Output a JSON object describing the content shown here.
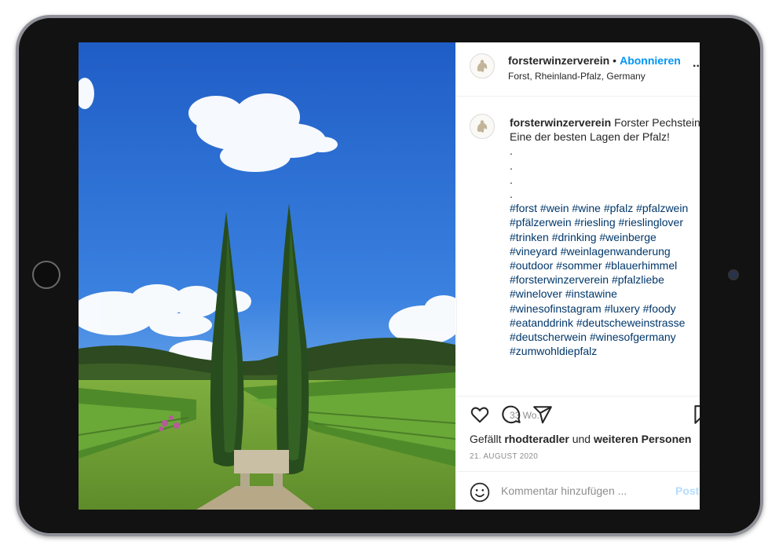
{
  "post": {
    "username": "forsterwinzerverein",
    "separator": "•",
    "follow_label": "Abonnieren",
    "location": "Forst, Rheinland-Pfalz, Germany",
    "more_label": "...",
    "caption_title": "Forster Pechstein -",
    "caption_line2": "Eine der besten Lagen der Pfalz!",
    "caption_dots": [
      ".",
      ".",
      ".",
      "."
    ],
    "hashtags": [
      "#forst #wein #wine #pfalz #pfalzwein",
      "#pfälzerwein #riesling #rieslinglover",
      "#trinken #drinking #weinberge",
      "#vineyard #weinlagenwanderung",
      "#outdoor #sommer #blauerhimmel",
      "#forsterwinzerverein #pfalzliebe",
      "#winelover #instawine",
      "#winesofinstagram #luxery #foody",
      "#eatanddrink #deutscheweinstrasse",
      "#deutscherwein #winesofgermany",
      "#zumwohldiepfalz"
    ],
    "time_ago": "33 Wo.",
    "likes_prefix": "Gefällt",
    "likes_user": "rhodteradler",
    "likes_and": "und",
    "likes_others": "weiteren Personen",
    "date": "21. AUGUST 2020",
    "comment_placeholder": "Kommentar hinzufügen ...",
    "post_label": "Posten"
  },
  "icons": [
    "heart-icon",
    "comment-icon",
    "share-icon",
    "bookmark-icon",
    "emoji-icon"
  ],
  "colors": {
    "link_blue": "#0095f6",
    "hashtag": "#00376b",
    "muted": "#8e8e8e",
    "tablet_body": "#121212",
    "tablet_frame": "#8f9098"
  }
}
